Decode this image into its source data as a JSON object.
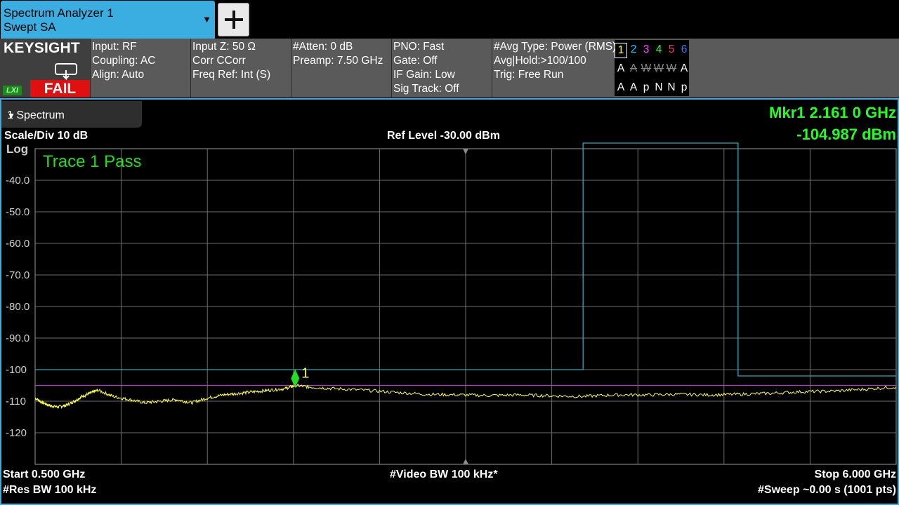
{
  "top": {
    "mode_line1": "Spectrum Analyzer 1",
    "mode_line2": "Swept SA",
    "mode_arrow": "▼",
    "add_icon": "plus-icon"
  },
  "settings": {
    "brand": "KEYSIGHT",
    "lxi": "LXI",
    "status": "FAIL",
    "col1": [
      "Input: RF",
      "Coupling: AC",
      "Align: Auto"
    ],
    "col2": [
      "Input Z: 50 Ω",
      "Corr CCorr",
      "Freq Ref: Int (S)"
    ],
    "col3": [
      "#Atten: 0 dB",
      "Preamp: 7.50 GHz"
    ],
    "col4": [
      "PNO: Fast",
      "Gate: Off",
      "IF Gain: Low",
      "Sig Track: Off"
    ],
    "col5": [
      "#Avg Type: Power (RMS)",
      "Avg|Hold:>100/100",
      "Trig: Free Run"
    ],
    "trace_numbers": [
      "1",
      "2",
      "3",
      "4",
      "5",
      "6"
    ],
    "trace_colors": [
      "#ffff00",
      "#00c8ff",
      "#ff40ff",
      "#30ff30",
      "#ff3060",
      "#3080ff"
    ],
    "trace_modes": [
      "A",
      "A",
      "W",
      "W",
      "W",
      "A"
    ],
    "trace_detectors": [
      "A",
      "A",
      "p",
      "N",
      "N",
      "p"
    ]
  },
  "window": {
    "title": "1 Spectrum",
    "arrow": "▼",
    "scale": "Scale/Div 10 dB",
    "log": "Log",
    "ref_level": "Ref Level -30.00 dBm",
    "marker_line1": "Mkr1  2.161 0 GHz",
    "marker_line2": "-104.987 dBm",
    "pass_text": "Trace 1 Pass",
    "start": "Start 0.500 GHz",
    "res_bw": "#Res BW 100 kHz",
    "video_bw": "#Video BW 100 kHz*",
    "stop": "Stop 6.000 GHz",
    "sweep": "#Sweep ~0.00 s (1001 pts)",
    "marker_label": "1"
  },
  "chart_data": {
    "type": "line",
    "x_unit": "GHz",
    "y_unit": "dBm",
    "xlim": [
      0.5,
      6.0
    ],
    "ylim": [
      -130,
      -30
    ],
    "y_ticks": [
      "-40.0",
      "-50.0",
      "-60.0",
      "-70.0",
      "-80.0",
      "-90.0",
      "-100",
      "-110",
      "-120"
    ],
    "y_tick_values": [
      -40,
      -50,
      -60,
      -70,
      -80,
      -90,
      -100,
      -110,
      -120
    ],
    "display_line": -105,
    "limit_line": {
      "x": [
        0.5,
        4.0,
        4.0,
        4.99,
        4.99,
        6.0
      ],
      "y": [
        -100,
        -100,
        -28,
        -28,
        -102,
        -102
      ]
    },
    "trace": {
      "x": [
        0.5,
        0.55,
        0.6,
        0.65,
        0.7,
        0.75,
        0.8,
        0.85,
        0.9,
        1.0,
        1.1,
        1.2,
        1.3,
        1.4,
        1.5,
        1.6,
        1.7,
        1.8,
        1.9,
        2.0,
        2.1,
        2.161,
        2.25,
        2.4,
        2.6,
        2.8,
        3.0,
        3.2,
        3.4,
        3.6,
        3.8,
        4.0,
        4.2,
        4.4,
        4.6,
        4.8,
        5.0,
        5.2,
        5.4,
        5.6,
        5.8,
        6.0
      ],
      "y": [
        -109.0,
        -110.5,
        -111.5,
        -111.8,
        -111.3,
        -110.0,
        -108.5,
        -107.5,
        -106.5,
        -108.5,
        -109.5,
        -110.5,
        -110.0,
        -109.5,
        -110.5,
        -109.0,
        -108.0,
        -107.5,
        -107.0,
        -106.5,
        -106.0,
        -105.0,
        -105.5,
        -106.0,
        -106.5,
        -107.2,
        -107.8,
        -108.0,
        -108.2,
        -108.0,
        -108.3,
        -108.5,
        -108.0,
        -108.0,
        -107.8,
        -108.0,
        -107.8,
        -107.5,
        -107.0,
        -106.8,
        -106.2,
        -105.5
      ]
    },
    "trace_color": "#ffff40",
    "limit_color": "#2fa9b8",
    "display_line_color": "#b040c0",
    "marker": {
      "x": 2.161,
      "y": -104.987,
      "color": "#22dd22"
    }
  }
}
